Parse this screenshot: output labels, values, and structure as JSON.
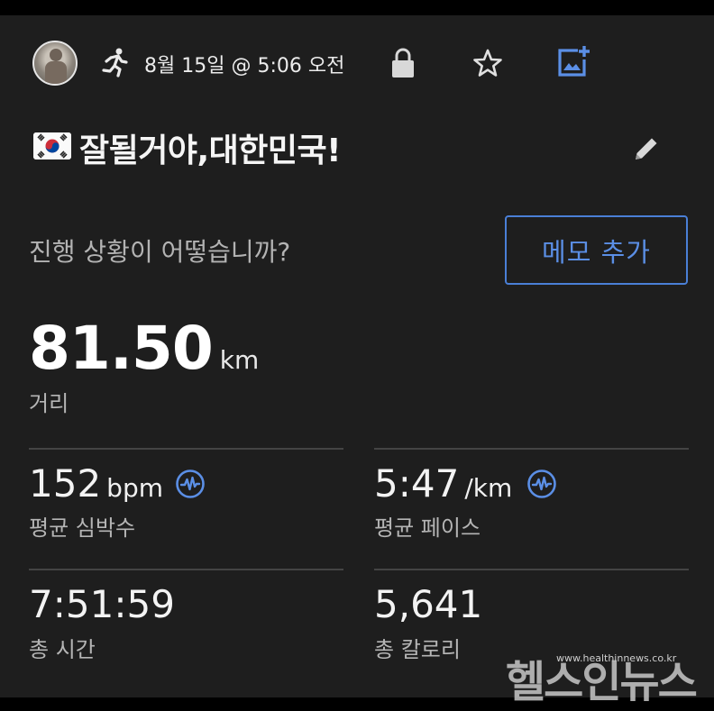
{
  "header": {
    "date_text": "8월 15일 @ 5:06 오전",
    "activity_icon": "running-person-icon",
    "privacy_icon": "lock-icon",
    "favorite_icon": "star-icon",
    "photo_icon": "add-photo-icon"
  },
  "activity": {
    "title": "잘될거야,대한민국!",
    "flag_icon": "south-korea-flag-icon",
    "edit_icon": "pencil-icon"
  },
  "prompt": {
    "question": "진행 상황이 어떻습니까?",
    "memo_button": "메모 추가"
  },
  "distance": {
    "value": "81.50",
    "unit": "km",
    "label": "거리"
  },
  "stats": {
    "heart_rate": {
      "value": "152",
      "unit": "bpm",
      "label": "평균 심박수"
    },
    "pace": {
      "value": "5:47",
      "unit": "/km",
      "label": "평균 페이스"
    },
    "time": {
      "value": "7:51:59",
      "label": "총 시간"
    },
    "calories": {
      "value": "5,641",
      "label": "총 칼로리"
    }
  },
  "watermark": {
    "text": "헬스인뉴스",
    "url": "www.healthinnews.co.kr"
  },
  "colors": {
    "background": "#1e1e1e",
    "accent": "#4a7fd6",
    "text_primary": "#f2f2f2",
    "text_secondary": "#b5b5b5"
  }
}
